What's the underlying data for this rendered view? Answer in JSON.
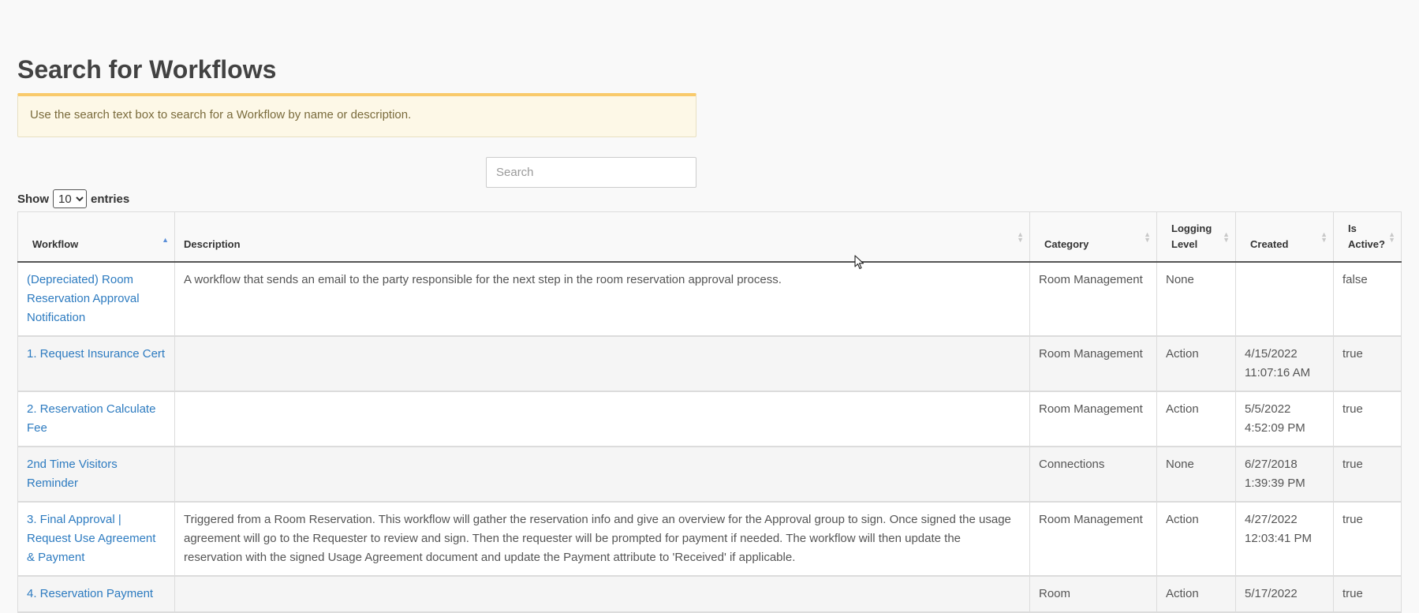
{
  "page": {
    "title": "Search for Workflows",
    "alert": "Use the search text box to search for a Workflow by name or description.",
    "search_placeholder": "Search",
    "length": {
      "show": "Show",
      "value": "10",
      "options": [
        "10"
      ],
      "entries": "entries"
    }
  },
  "table": {
    "headers": {
      "workflow": "Workflow",
      "description": "Description",
      "category": "Category",
      "logging": "Logging Level",
      "created": "Created",
      "active": "Is Active?"
    },
    "sort_column": "workflow",
    "rows": [
      {
        "workflow": "(Depreciated) Room Reservation Approval Notification",
        "description": "A workflow that sends an email to the party responsible for the next step in the room reservation approval process.",
        "category": "Room Management",
        "logging": "None",
        "created": "",
        "active": "false"
      },
      {
        "workflow": "1. Request Insurance Cert",
        "description": "",
        "category": "Room Management",
        "logging": "Action",
        "created": "4/15/2022 11:07:16 AM",
        "active": "true"
      },
      {
        "workflow": "2. Reservation Calculate Fee",
        "description": "",
        "category": "Room Management",
        "logging": "Action",
        "created": "5/5/2022 4:52:09 PM",
        "active": "true"
      },
      {
        "workflow": "2nd Time Visitors Reminder",
        "description": "",
        "category": "Connections",
        "logging": "None",
        "created": "6/27/2018 1:39:39 PM",
        "active": "true"
      },
      {
        "workflow": "3. Final Approval | Request Use Agreement & Payment",
        "description": "Triggered from a Room Reservation. This workflow will gather the reservation info and give an overview for the Approval group to sign. Once signed the usage agreement will go to the Requester to review and sign. Then the requester will be prompted for payment if needed. The workflow will then update the reservation with the signed Usage Agreement document and update the Payment attribute to 'Received' if applicable.",
        "category": "Room Management",
        "logging": "Action",
        "created": "4/27/2022 12:03:41 PM",
        "active": "true"
      },
      {
        "workflow": "4. Reservation Payment",
        "description": "",
        "category": "Room",
        "logging": "Action",
        "created": "5/17/2022",
        "active": "true"
      }
    ]
  },
  "colors": {
    "link": "#2d7bc0",
    "alert_bg": "#fdf8e7",
    "alert_border": "#f9ca6b",
    "sort_active": "#5b8fd9"
  },
  "icons": [
    "mouse-cursor-icon",
    "sort-arrows-icon"
  ]
}
